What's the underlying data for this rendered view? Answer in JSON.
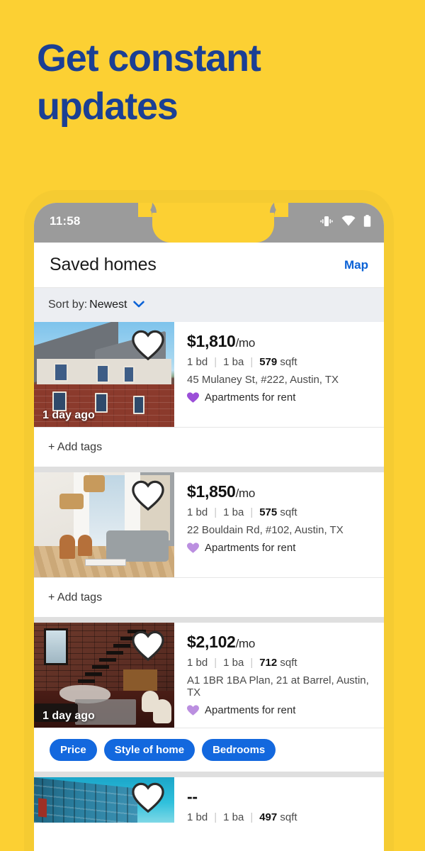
{
  "promo": {
    "headline_line1": "Get constant",
    "headline_line2": "updates",
    "bg_color": "#FCD033",
    "headline_color": "#1B3F94"
  },
  "status_bar": {
    "time": "11:58",
    "icons": [
      "vibrate-icon",
      "wifi-icon",
      "battery-icon"
    ]
  },
  "app_header": {
    "title": "Saved homes",
    "map_link": "Map",
    "link_color": "#0B62D6"
  },
  "sort_bar": {
    "label": "Sort by:",
    "value": "Newest",
    "chevron": "chevron-down-icon"
  },
  "listings": [
    {
      "price": "$1,810",
      "price_unit": "/mo",
      "beds": "1 bd",
      "baths": "1 ba",
      "sqft": "579",
      "sqft_unit": "sqft",
      "address": "45 Mulaney St, #222, Austin, TX",
      "tagline": "Apartments for rent",
      "tagline_heart_color": "#9B4FD8",
      "badge": "1 day ago",
      "photo": "townhome-exterior",
      "footer_type": "add_tags",
      "add_tags_label": "+ Add tags"
    },
    {
      "price": "$1,850",
      "price_unit": "/mo",
      "beds": "1 bd",
      "baths": "1 ba",
      "sqft": "575",
      "sqft_unit": "sqft",
      "address": "22 Bouldain Rd, #102, Austin, TX",
      "tagline": "Apartments for rent",
      "tagline_heart_color": "#BB8FE0",
      "badge": "",
      "photo": "living-room",
      "footer_type": "add_tags",
      "add_tags_label": "+ Add tags"
    },
    {
      "price": "$2,102",
      "price_unit": "/mo",
      "beds": "1 bd",
      "baths": "1 ba",
      "sqft": "712",
      "sqft_unit": "sqft",
      "address": "A1 1BR 1BA Plan, 21 at Barrel, Austin, TX",
      "tagline": "Apartments for rent",
      "tagline_heart_color": "#BB8FE0",
      "badge": "1 day ago",
      "photo": "brick-loft",
      "footer_type": "pills",
      "pills": [
        "Price",
        "Style of home",
        "Bedrooms"
      ],
      "pill_color": "#1368DE"
    },
    {
      "price": "--",
      "price_unit": "",
      "beds": "1 bd",
      "baths": "1 ba",
      "sqft": "497",
      "sqft_unit": "sqft",
      "address": "",
      "tagline": "",
      "badge": "",
      "photo": "blue-apartments",
      "footer_type": "none"
    }
  ]
}
